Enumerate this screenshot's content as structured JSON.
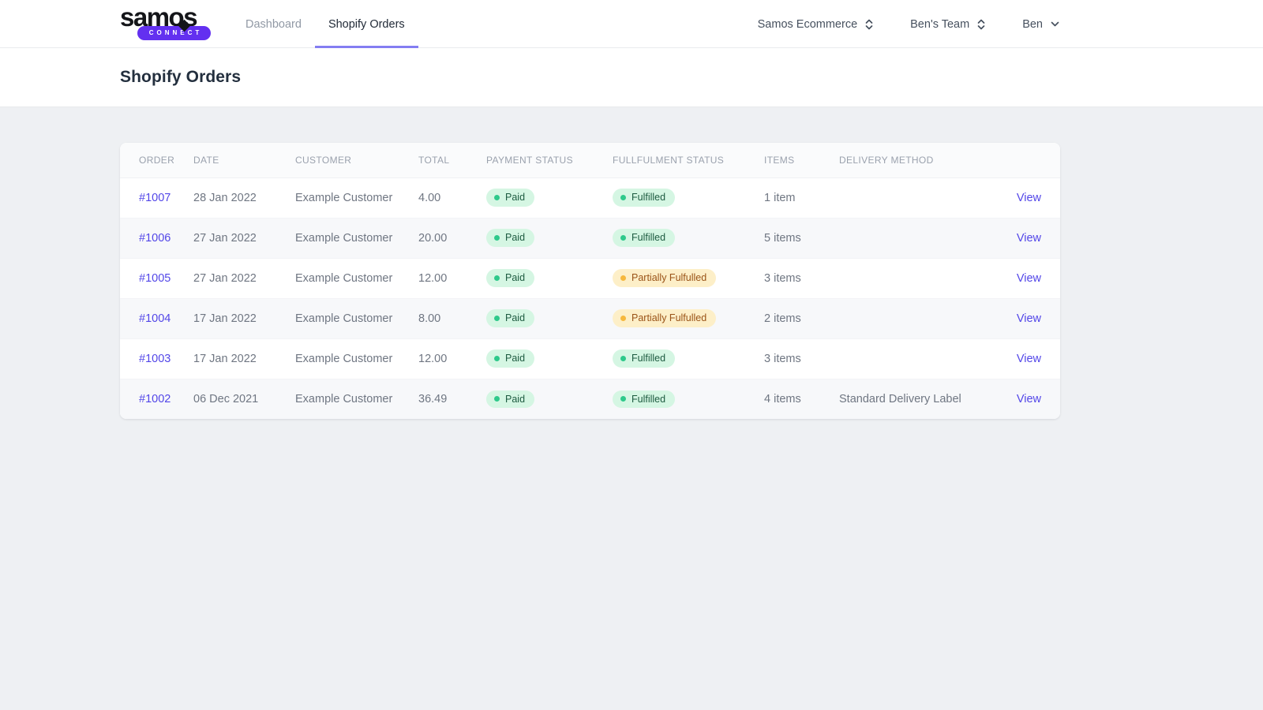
{
  "brand": {
    "name": "samos",
    "badge": "CONNECT",
    "badge_color": "#6330f0"
  },
  "nav": {
    "tabs": [
      {
        "label": "Dashboard",
        "active": false
      },
      {
        "label": "Shopify Orders",
        "active": true
      }
    ]
  },
  "header_selectors": {
    "organisation": "Samos Ecommerce",
    "team": "Ben's Team",
    "user": "Ben"
  },
  "page": {
    "title": "Shopify Orders"
  },
  "table": {
    "columns": {
      "order": "ORDER",
      "date": "DATE",
      "customer": "CUSTOMER",
      "total": "TOTAL",
      "payment_status": "PAYMENT STATUS",
      "fulfilment_status": "FULLFULMENT STATUS",
      "items": "ITEMS",
      "delivery_method": "DELIVERY METHOD",
      "action": ""
    },
    "rows": [
      {
        "order": "#1007",
        "date": "28 Jan 2022",
        "customer": "Example Customer",
        "total": "4.00",
        "payment_status": "Paid",
        "payment_variant": "success",
        "fulfilment_status": "Fulfilled",
        "fulfilment_variant": "success",
        "items": "1 item",
        "delivery_method": "",
        "action": "View"
      },
      {
        "order": "#1006",
        "date": "27 Jan 2022",
        "customer": "Example Customer",
        "total": "20.00",
        "payment_status": "Paid",
        "payment_variant": "success",
        "fulfilment_status": "Fulfilled",
        "fulfilment_variant": "success",
        "items": "5 items",
        "delivery_method": "",
        "action": "View"
      },
      {
        "order": "#1005",
        "date": "27 Jan 2022",
        "customer": "Example Customer",
        "total": "12.00",
        "payment_status": "Paid",
        "payment_variant": "success",
        "fulfilment_status": "Partially Fulfulled",
        "fulfilment_variant": "warning",
        "items": "3 items",
        "delivery_method": "",
        "action": "View"
      },
      {
        "order": "#1004",
        "date": "17 Jan 2022",
        "customer": "Example Customer",
        "total": "8.00",
        "payment_status": "Paid",
        "payment_variant": "success",
        "fulfilment_status": "Partially Fulfulled",
        "fulfilment_variant": "warning",
        "items": "2 items",
        "delivery_method": "",
        "action": "View"
      },
      {
        "order": "#1003",
        "date": "17 Jan 2022",
        "customer": "Example Customer",
        "total": "12.00",
        "payment_status": "Paid",
        "payment_variant": "success",
        "fulfilment_status": "Fulfilled",
        "fulfilment_variant": "success",
        "items": "3 items",
        "delivery_method": "",
        "action": "View"
      },
      {
        "order": "#1002",
        "date": "06 Dec 2021",
        "customer": "Example Customer",
        "total": "36.49",
        "payment_status": "Paid",
        "payment_variant": "success",
        "fulfilment_status": "Fulfilled",
        "fulfilment_variant": "success",
        "items": "4 items",
        "delivery_method": "Standard Delivery Label",
        "action": "View"
      }
    ]
  },
  "colors": {
    "accent_indigo": "#5246e8",
    "tab_underline": "#837df2",
    "badge_success_bg": "#d5f6e3",
    "badge_success_dot": "#2ec98b",
    "badge_warning_bg": "#fdefc8",
    "badge_warning_dot": "#f6b83d",
    "page_background": "#eef0f3"
  }
}
